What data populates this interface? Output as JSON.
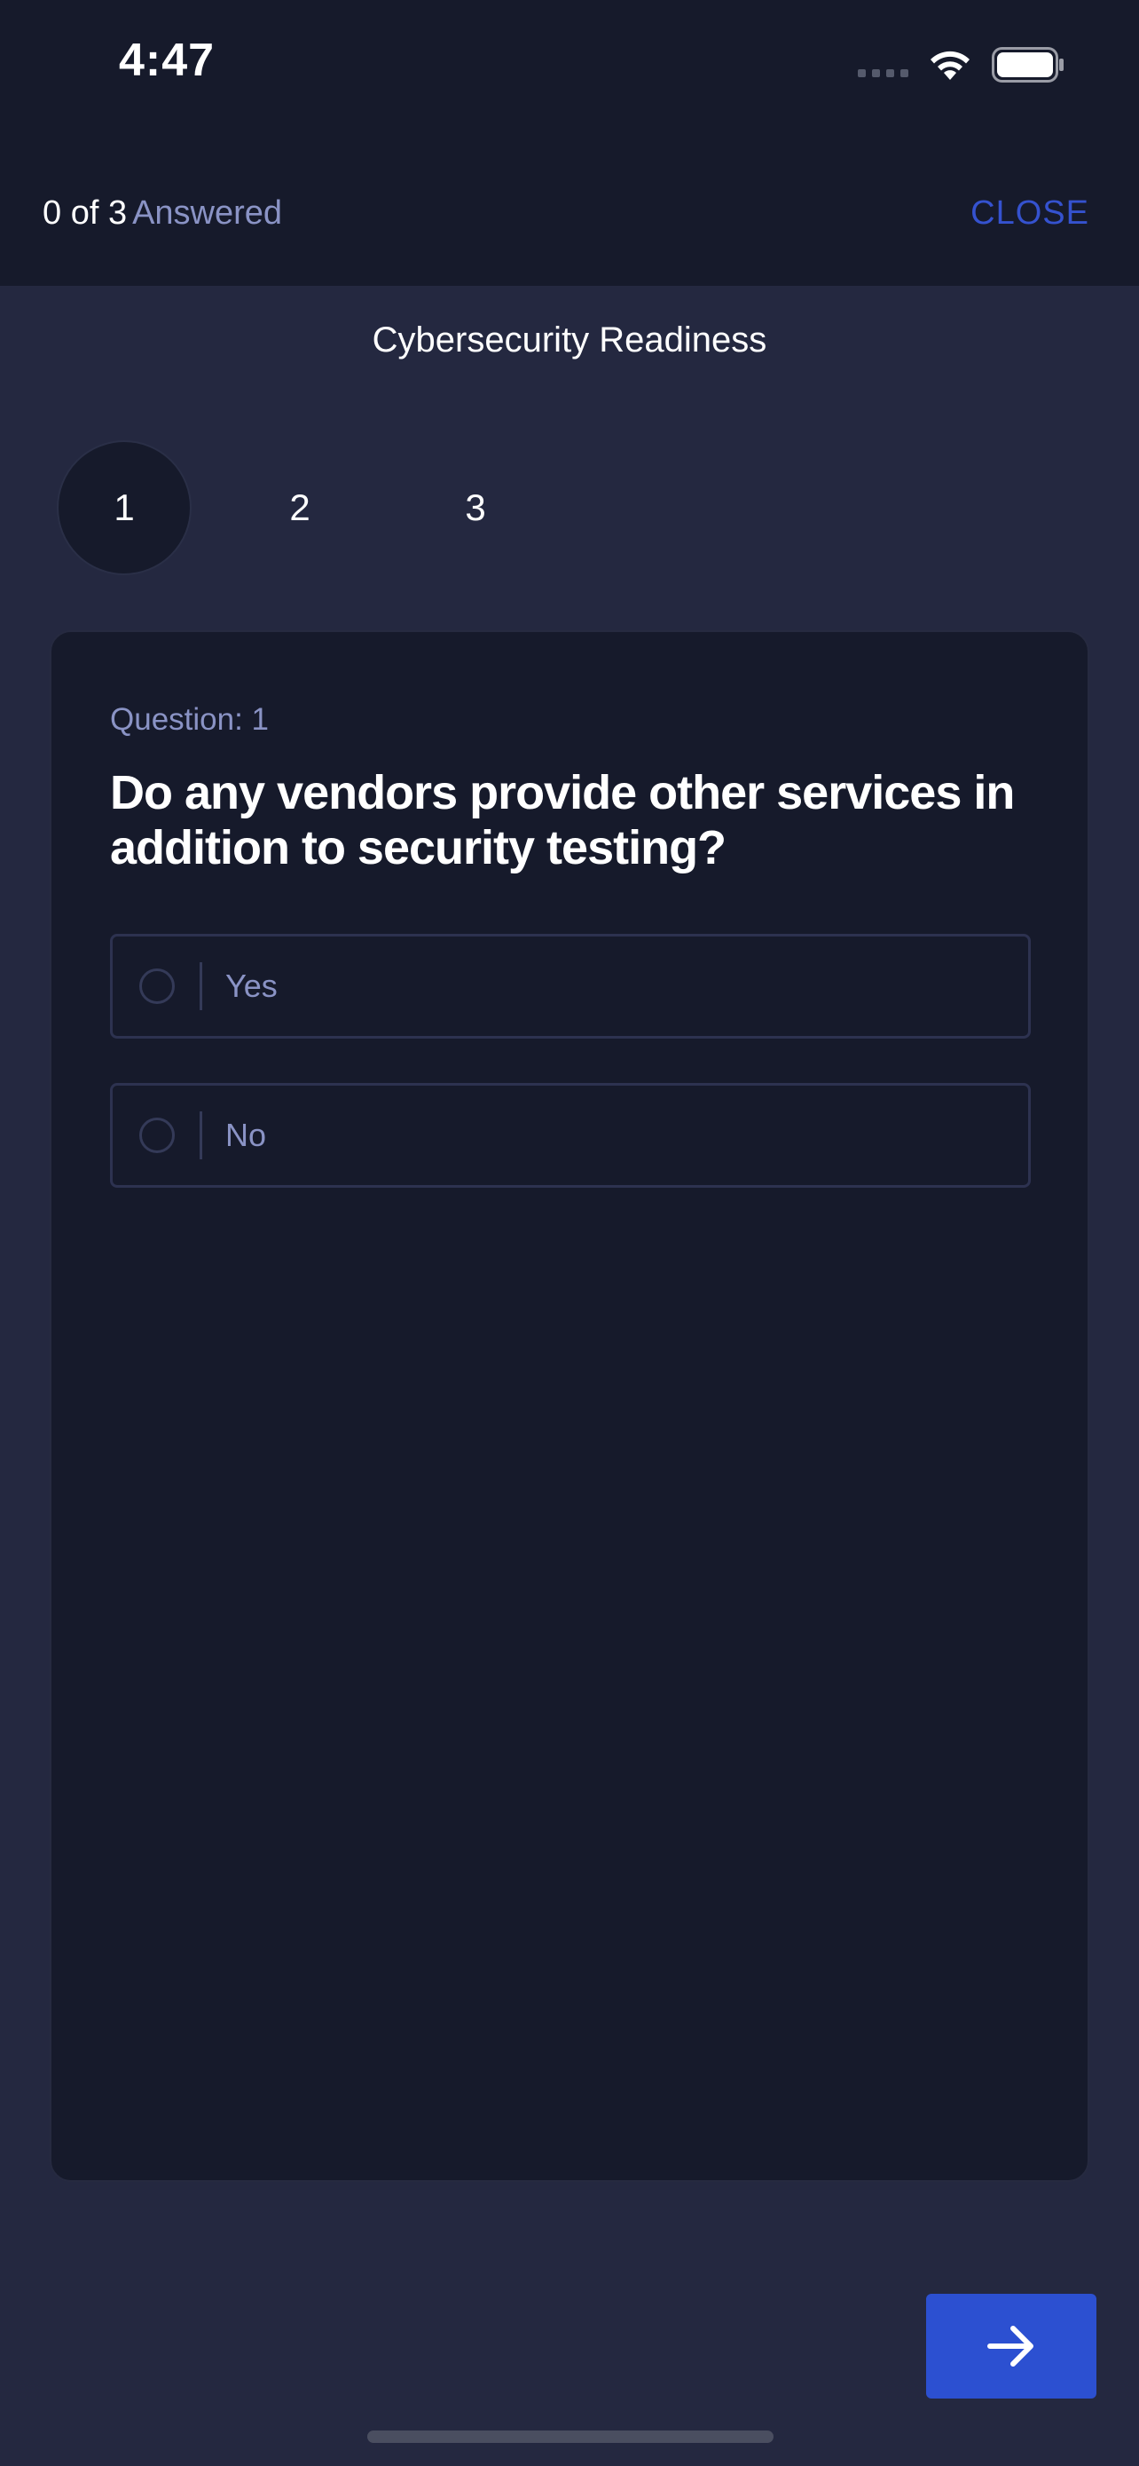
{
  "status_bar": {
    "time": "4:47",
    "icons": [
      "cellular-signal-icon",
      "wifi-icon",
      "battery-icon"
    ]
  },
  "header": {
    "answered_count": "0 of 3",
    "answered_label": "Answered",
    "close_label": "CLOSE"
  },
  "survey": {
    "title": "Cybersecurity Readiness",
    "steps": [
      "1",
      "2",
      "3"
    ],
    "active_step": "1"
  },
  "question": {
    "label": "Question: 1",
    "text": "Do any vendors provide other services in addition to security testing?",
    "options": [
      "Yes",
      "No"
    ]
  },
  "navigation": {
    "next_icon": "arrow-right-icon"
  },
  "colors": {
    "background": "#242840",
    "header_background": "#161a2b",
    "card_background": "#161a2b",
    "accent": "#2c50d1",
    "muted_text": "#8a93c5"
  }
}
